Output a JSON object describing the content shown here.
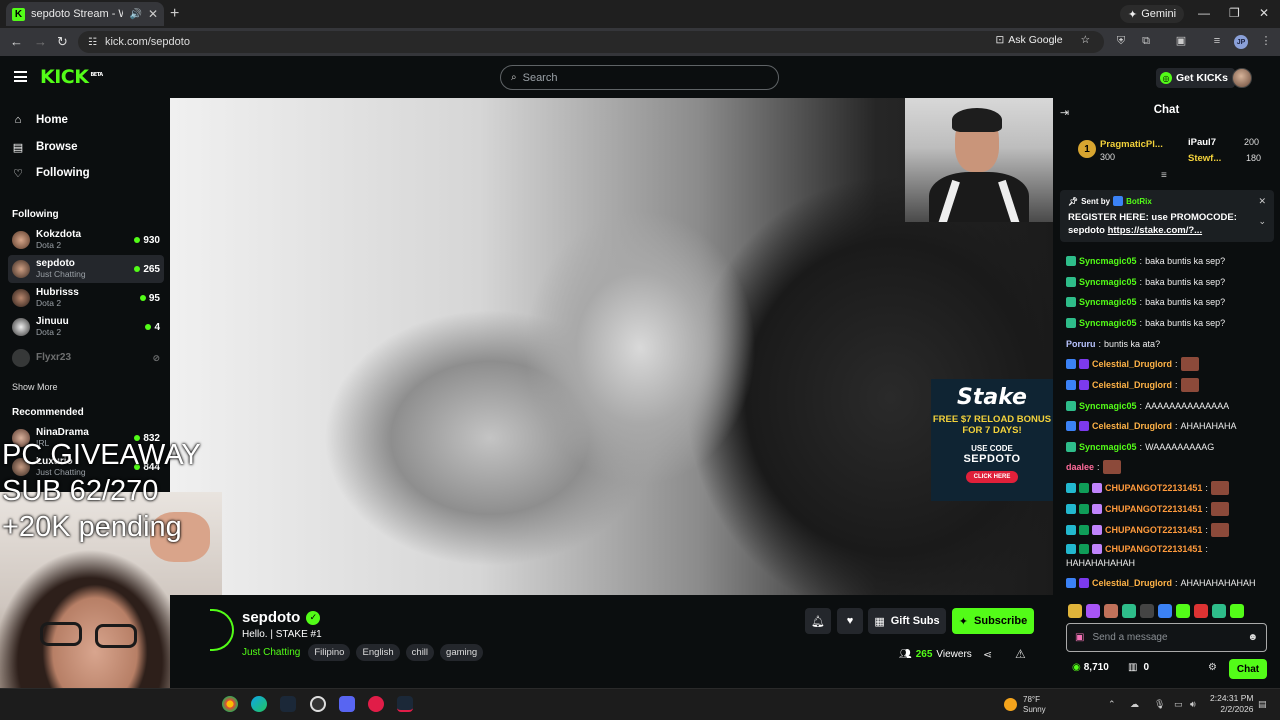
{
  "browser": {
    "tab_title": "sepdoto Stream - Watch Li",
    "tab_icon": "K",
    "new_tab": "+",
    "gemini_label": "Gemini",
    "url": "kick.com/sepdoto",
    "ask_google": "Ask Google",
    "profile_initials": "JP"
  },
  "header": {
    "logo": "KICK",
    "logo_tag": "BETA",
    "search_placeholder": "Search",
    "get_kicks": "Get KICKs"
  },
  "sidebar": {
    "nav": [
      {
        "label": "Home",
        "icon": "home-icon"
      },
      {
        "label": "Browse",
        "icon": "browse-icon"
      },
      {
        "label": "Following",
        "icon": "heart-icon"
      }
    ],
    "following_title": "Following",
    "following": [
      {
        "name": "Kokzdota",
        "category": "Dota 2",
        "viewers": "930"
      },
      {
        "name": "sepdoto",
        "category": "Just Chatting",
        "viewers": "265"
      },
      {
        "name": "Hubrisss",
        "category": "Dota 2",
        "viewers": "95"
      },
      {
        "name": "Jinuuu",
        "category": "Dota 2",
        "viewers": "4"
      },
      {
        "name": "Flyxr23",
        "category": "",
        "viewers": ""
      }
    ],
    "show_more": "Show More",
    "recommended_title": "Recommended",
    "recommended": [
      {
        "name": "NinaDrama",
        "category": "IRL",
        "viewers": "832"
      },
      {
        "name": "Luxurio",
        "category": "Just Chatting",
        "viewers": "844"
      }
    ]
  },
  "overlay": {
    "line1": "PC GIVEAWAY",
    "line2": "SUB 62/270",
    "line3": "+20K pending"
  },
  "ad": {
    "brand": "Stake",
    "promo": "FREE $7 RELOAD BONUS FOR 7 DAYS!",
    "use_code": "USE CODE",
    "code": "SEPDOTO",
    "cta": "CLICK HERE"
  },
  "stream": {
    "streamer": "sepdoto",
    "title": "Hello. | STAKE #1",
    "category": "Just Chatting",
    "tags": [
      "Filipino",
      "English",
      "chill",
      "gaming"
    ],
    "viewers": "265",
    "viewers_label": "Viewers",
    "gift_subs": "Gift Subs",
    "subscribe": "Subscribe"
  },
  "chat": {
    "title": "Chat",
    "leaderboard": [
      {
        "rank": "1",
        "name": "PragmaticPl...",
        "value": "300"
      },
      {
        "name": "iPaul7",
        "value": "200"
      },
      {
        "name": "Stewf...",
        "value": "180"
      }
    ],
    "pinned": {
      "sent_by": "Sent by",
      "bot": "BotRix",
      "message": "REGISTER HERE: use PROMOCODE: sepdoto",
      "link": "https://stake.com/?..."
    },
    "messages": [
      {
        "user": "Syncmagic05",
        "text": "baka buntis ka sep?",
        "color": "#53fc18"
      },
      {
        "user": "Syncmagic05",
        "text": "baka buntis ka sep?",
        "color": "#53fc18"
      },
      {
        "user": "Syncmagic05",
        "text": "baka buntis ka sep?",
        "color": "#53fc18"
      },
      {
        "user": "Syncmagic05",
        "text": "baka buntis ka sep?",
        "color": "#53fc18"
      },
      {
        "user": "Poruru",
        "text": "buntis ka ata?",
        "color": "#b9c4ff"
      },
      {
        "user": "Celestial_Druglord",
        "text": "",
        "color": "#ffb347"
      },
      {
        "user": "Celestial_Druglord",
        "text": "",
        "color": "#ffb347"
      },
      {
        "user": "Syncmagic05",
        "text": "AAAAAAAAAAAAAA",
        "color": "#53fc18"
      },
      {
        "user": "Celestial_Druglord",
        "text": "AHAHAHAHA",
        "color": "#ffb347"
      },
      {
        "user": "Syncmagic05",
        "text": "WAAAAAAAAAG",
        "color": "#53fc18"
      },
      {
        "user": "daalee",
        "text": "",
        "color": "#ff6b9a"
      },
      {
        "user": "CHUPANGOT22131451",
        "text": "",
        "color": "#ff9a3c"
      },
      {
        "user": "CHUPANGOT22131451",
        "text": "",
        "color": "#ff9a3c"
      },
      {
        "user": "CHUPANGOT22131451",
        "text": "",
        "color": "#ff9a3c"
      },
      {
        "user": "CHUPANGOT22131451",
        "text": "HAHAHAHAHAH",
        "color": "#ff9a3c"
      },
      {
        "user": "Celestial_Druglord",
        "text": "AHAHAHAHAHAH",
        "color": "#ffb347"
      }
    ],
    "input_placeholder": "Send a message",
    "kicks_balance": "8,710",
    "points": "0",
    "send_label": "Chat"
  },
  "taskbar": {
    "weather_temp": "78°F",
    "weather_desc": "Sunny",
    "time": "2:24:31 PM",
    "date": "2/2/2026"
  }
}
